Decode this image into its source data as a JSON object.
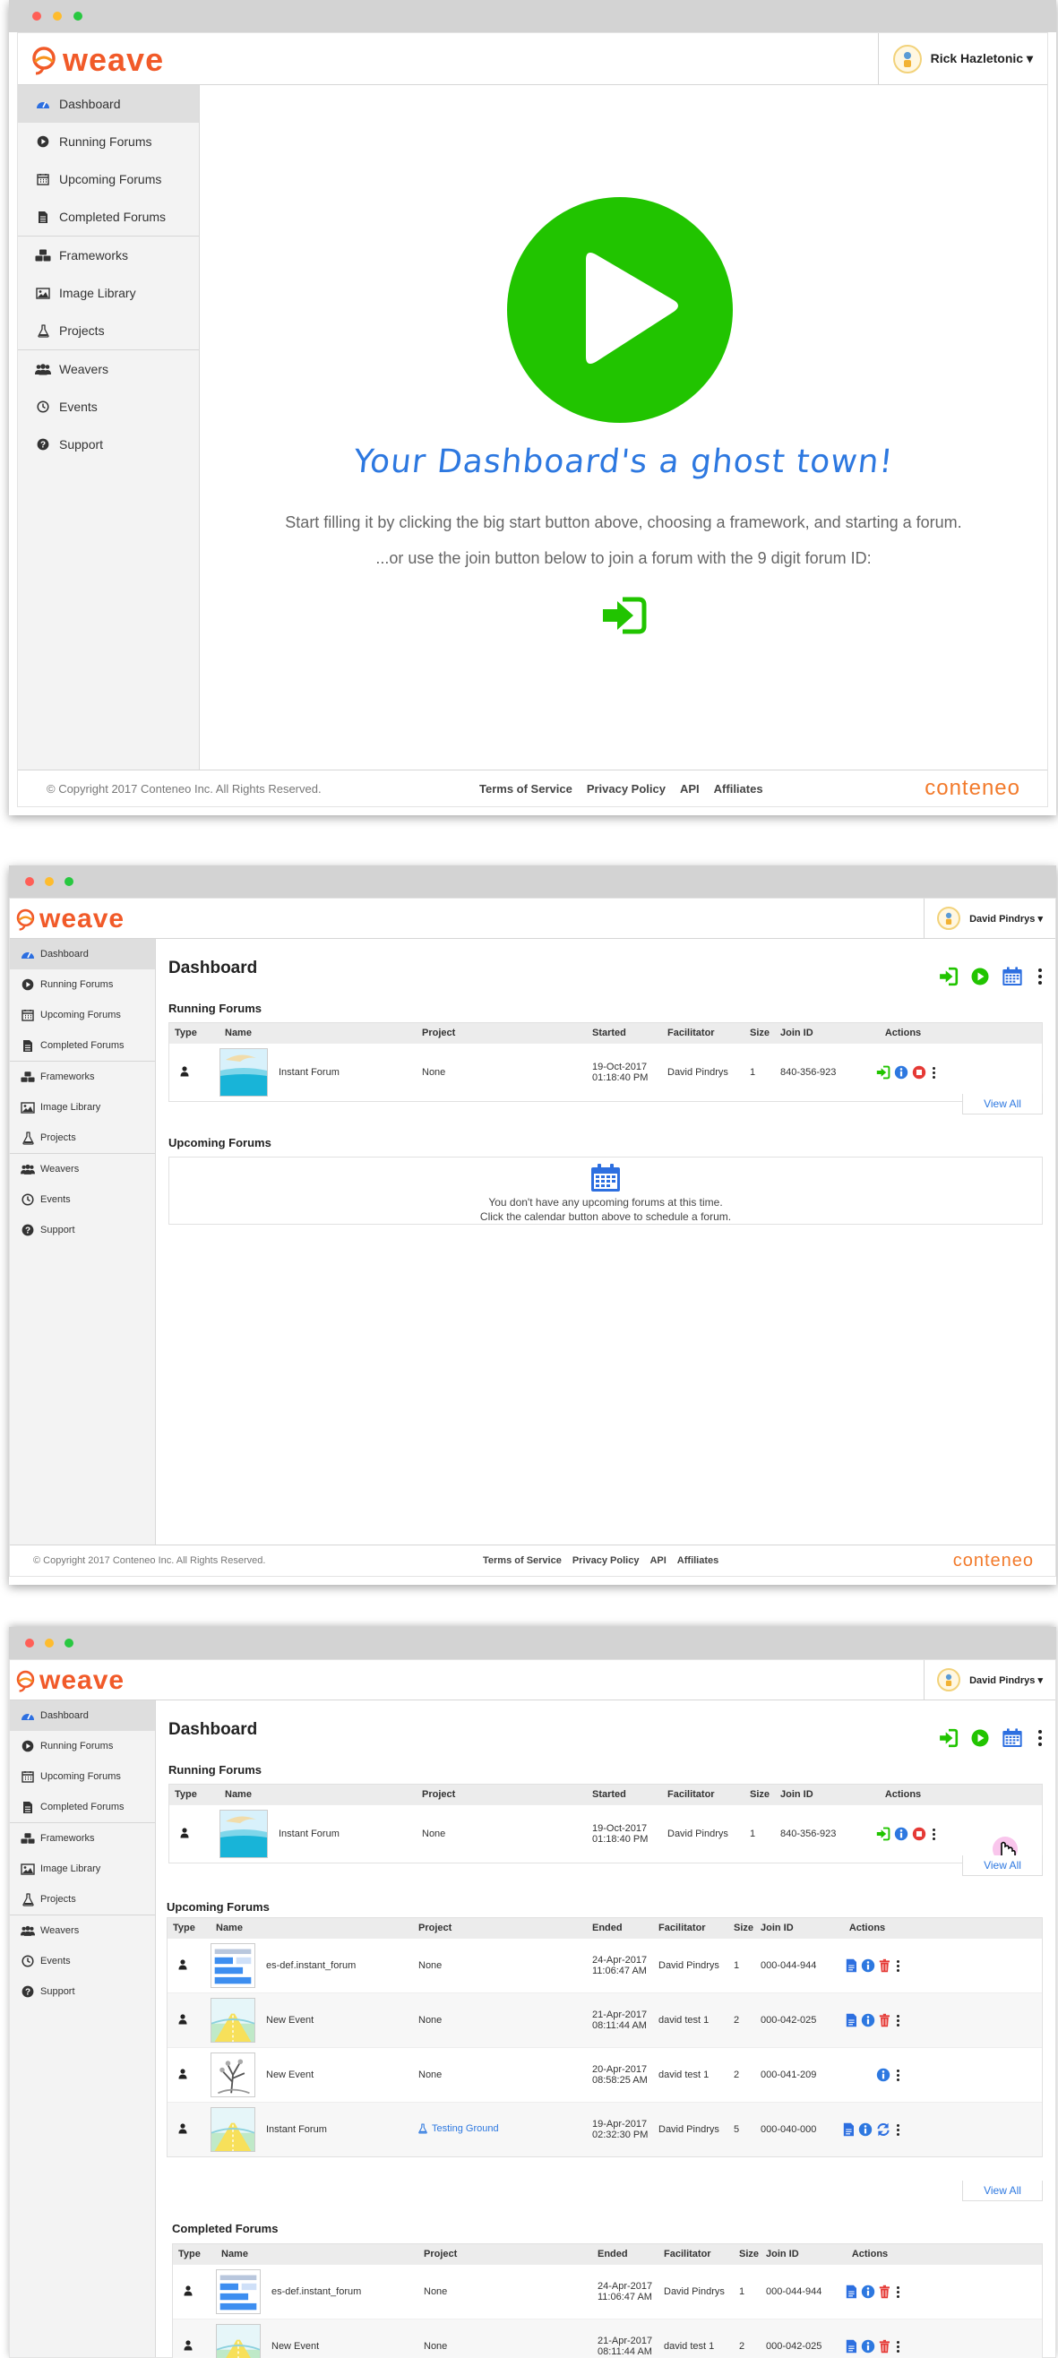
{
  "brand": {
    "logo_text": "weave",
    "footer_brand": "conteneo"
  },
  "colors": {
    "accent": "#f15a29",
    "play_green": "#21c400",
    "link_blue": "#2d78e0",
    "stop_red": "#e53935",
    "sidebar_bg": "#f3f3f3"
  },
  "nav": {
    "items": [
      {
        "label": "Dashboard",
        "icon": "dashboard-gauge-icon"
      },
      {
        "label": "Running Forums",
        "icon": "play-circle-icon"
      },
      {
        "label": "Upcoming Forums",
        "icon": "calendar-icon"
      },
      {
        "label": "Completed Forums",
        "icon": "document-icon"
      },
      {
        "label": "Frameworks",
        "icon": "cubes-icon"
      },
      {
        "label": "Image Library",
        "icon": "image-icon"
      },
      {
        "label": "Projects",
        "icon": "flask-icon"
      },
      {
        "label": "Weavers",
        "icon": "users-icon"
      },
      {
        "label": "Events",
        "icon": "clock-icon"
      },
      {
        "label": "Support",
        "icon": "question-circle-icon"
      }
    ]
  },
  "footer": {
    "copyright": "© Copyright 2017 Conteneo Inc. All Rights Reserved.",
    "links": [
      "Terms of Service",
      "Privacy Policy",
      "API",
      "Affiliates"
    ]
  },
  "screen1": {
    "user": "Rick Hazletonic ▾",
    "headline": "Your Dashboard's a ghost town!",
    "line1": "Start filling it by clicking the big start button above, choosing a framework, and starting a forum.",
    "line2": "...or use the join button below to join a forum with the 9 digit forum ID:"
  },
  "screen2": {
    "user": "David Pindrys ▾",
    "page_title": "Dashboard",
    "running_title": "Running Forums",
    "running_headers": [
      "Type",
      "Name",
      "Project",
      "Started",
      "Facilitator",
      "Size",
      "Join ID",
      "Actions"
    ],
    "running_rows": [
      {
        "name": "Instant Forum",
        "project": "None",
        "date": "19-Oct-2017",
        "time": "01:18:40 PM",
        "facilitator": "David Pindrys",
        "size": "1",
        "join_id": "840-356-923"
      }
    ],
    "view_all": "View All",
    "upcoming_title": "Upcoming Forums",
    "empty_line1": "You don't have any upcoming forums at this time.",
    "empty_line2": "Click the calendar button above to schedule a forum."
  },
  "screen3": {
    "user": "David Pindrys ▾",
    "page_title": "Dashboard",
    "running_title": "Running Forums",
    "running_headers": [
      "Type",
      "Name",
      "Project",
      "Started",
      "Facilitator",
      "Size",
      "Join ID",
      "Actions"
    ],
    "running_rows": [
      {
        "name": "Instant Forum",
        "project": "None",
        "date": "19-Oct-2017",
        "time": "01:18:40 PM",
        "facilitator": "David Pindrys",
        "size": "1",
        "join_id": "840-356-923"
      }
    ],
    "view_all": "View All",
    "upcoming_title": "Upcoming Forums",
    "upcoming_headers": [
      "Type",
      "Name",
      "Project",
      "Ended",
      "Facilitator",
      "Size",
      "Join ID",
      "Actions"
    ],
    "upcoming_rows": [
      {
        "name": "es-def.instant_forum",
        "project": "None",
        "date": "24-Apr-2017",
        "time": "11:06:47 AM",
        "facilitator": "David Pindrys",
        "size": "1",
        "join_id": "000-044-944"
      },
      {
        "name": "New Event",
        "project": "None",
        "date": "21-Apr-2017",
        "time": "08:11:44 AM",
        "facilitator": "david test 1",
        "size": "2",
        "join_id": "000-042-025"
      },
      {
        "name": "New Event",
        "project": "None",
        "date": "20-Apr-2017",
        "time": "08:58:25 AM",
        "facilitator": "david test 1",
        "size": "2",
        "join_id": "000-041-209"
      },
      {
        "name": "Instant Forum",
        "project": "Testing Ground",
        "date": "19-Apr-2017",
        "time": "02:32:30 PM",
        "facilitator": "David Pindrys",
        "size": "5",
        "join_id": "000-040-000"
      }
    ],
    "completed_title": "Completed Forums",
    "completed_headers": [
      "Type",
      "Name",
      "Project",
      "Ended",
      "Facilitator",
      "Size",
      "Join ID",
      "Actions"
    ],
    "completed_rows": [
      {
        "name": "es-def.instant_forum",
        "project": "None",
        "date": "24-Apr-2017",
        "time": "11:06:47 AM",
        "facilitator": "David Pindrys",
        "size": "1",
        "join_id": "000-044-944"
      },
      {
        "name": "New Event",
        "project": "None",
        "date": "21-Apr-2017",
        "time": "08:11:44 AM",
        "facilitator": "david test 1",
        "size": "2",
        "join_id": "000-042-025"
      }
    ]
  }
}
